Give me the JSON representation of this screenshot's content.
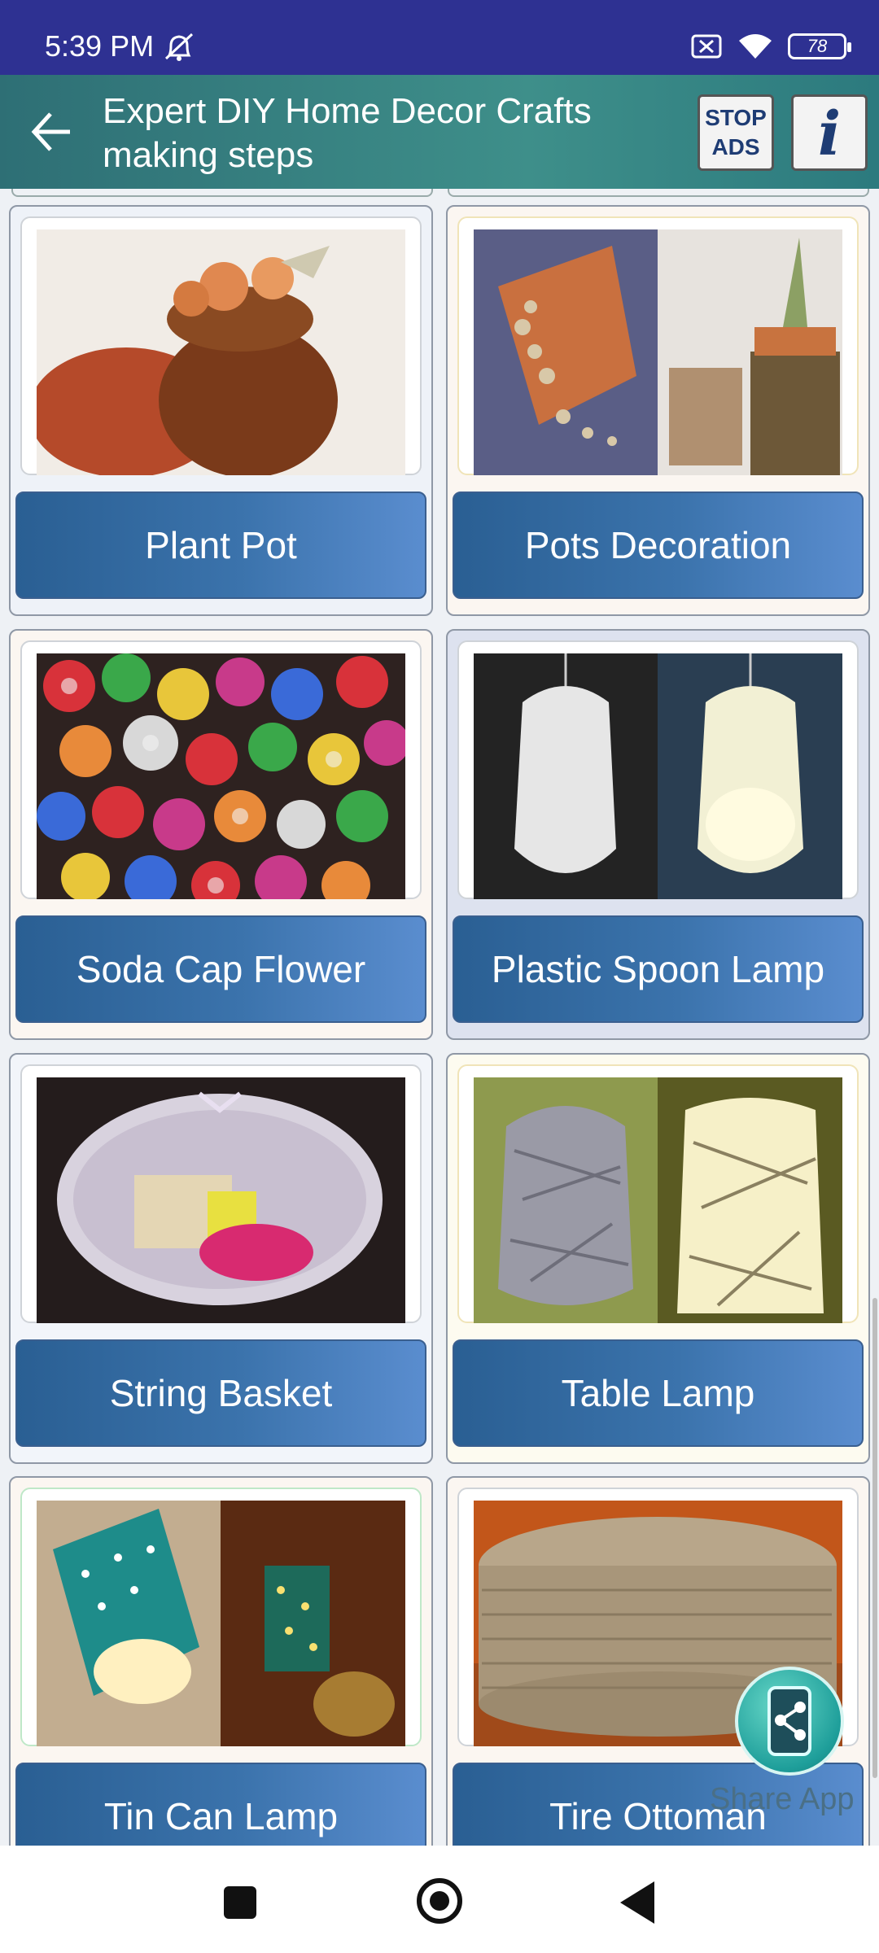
{
  "status_bar": {
    "time": "5:39 PM",
    "battery": "78"
  },
  "app_bar": {
    "title": "Expert DIY Home Decor Crafts making steps",
    "stop_ads_line1": "STOP",
    "stop_ads_line2": "ADS",
    "info_glyph": "i"
  },
  "items": [
    {
      "label": "Plant Pot",
      "image": "plant-pot-image"
    },
    {
      "label": "Pots Decoration",
      "image": "pots-decoration-image"
    },
    {
      "label": "Soda Cap Flower",
      "image": "soda-cap-flower-image"
    },
    {
      "label": "Plastic Spoon Lamp",
      "image": "plastic-spoon-lamp-image"
    },
    {
      "label": "String Basket",
      "image": "string-basket-image"
    },
    {
      "label": "Table Lamp",
      "image": "table-lamp-image"
    },
    {
      "label": "Tin Can Lamp",
      "image": "tin-can-lamp-image"
    },
    {
      "label": "Tire Ottoman",
      "image": "tire-ottoman-image"
    }
  ],
  "fab": {
    "label": "Share App",
    "icon": "share-phone-icon"
  },
  "colors": {
    "status_bar": "#2e3192",
    "app_bar": "#3e8f8a",
    "button": "#3b73ac"
  }
}
